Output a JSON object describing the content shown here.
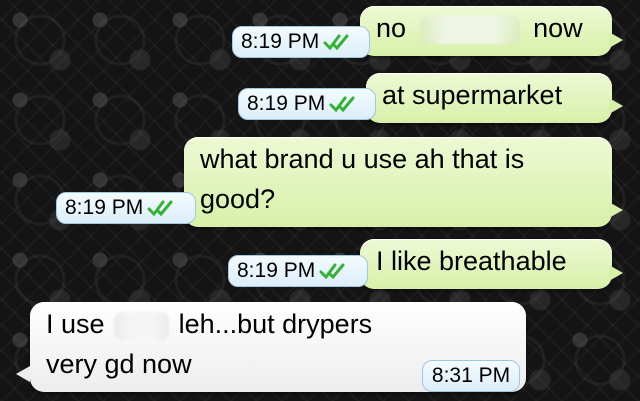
{
  "messages": [
    {
      "direction": "out",
      "text_before": "no",
      "text_after": "now",
      "time": "8:19 PM",
      "status": "read-ticks-icon"
    },
    {
      "direction": "out",
      "text": "at supermarket",
      "time": "8:19 PM",
      "status": "read-ticks-icon"
    },
    {
      "direction": "out",
      "line1": "what brand u use ah that is",
      "line2": "good?",
      "time": "8:19 PM",
      "status": "read-ticks-icon"
    },
    {
      "direction": "out",
      "text": "I like breathable",
      "time": "8:19 PM",
      "status": "read-ticks-icon"
    },
    {
      "direction": "in",
      "line1_before": "I use",
      "line1_after": "leh...but drypers",
      "line2": "very gd now",
      "time": "8:31 PM"
    }
  ],
  "colors": {
    "outgoing_bubble": "#dcf8c6",
    "incoming_bubble": "#ffffff",
    "tick": "#34b233",
    "timestamp_border": "#9fc7e6"
  }
}
